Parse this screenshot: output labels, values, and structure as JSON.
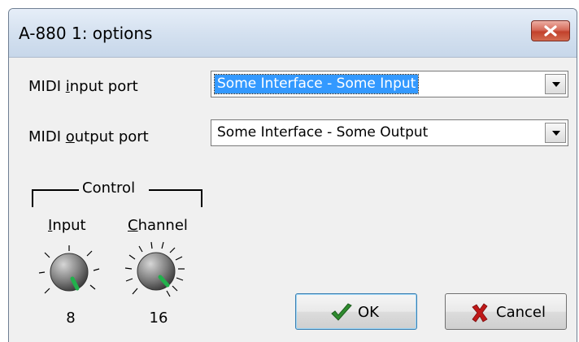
{
  "window": {
    "title": "A-880 1: options"
  },
  "midi_input": {
    "label": "MIDI input port",
    "value": "Some Interface - Some Input"
  },
  "midi_output": {
    "label": "MIDI output port",
    "value": "Some Interface - Some Output"
  },
  "control": {
    "title": "Control",
    "input_knob": {
      "label": "Input",
      "value": "8"
    },
    "channel_knob": {
      "label": "Channel",
      "value": "16"
    }
  },
  "buttons": {
    "ok": "OK",
    "cancel": "Cancel"
  },
  "colors": {
    "knob_pointer": "#22b14c",
    "ok_check": "#2e8b2e",
    "cancel_x": "#c01818"
  }
}
